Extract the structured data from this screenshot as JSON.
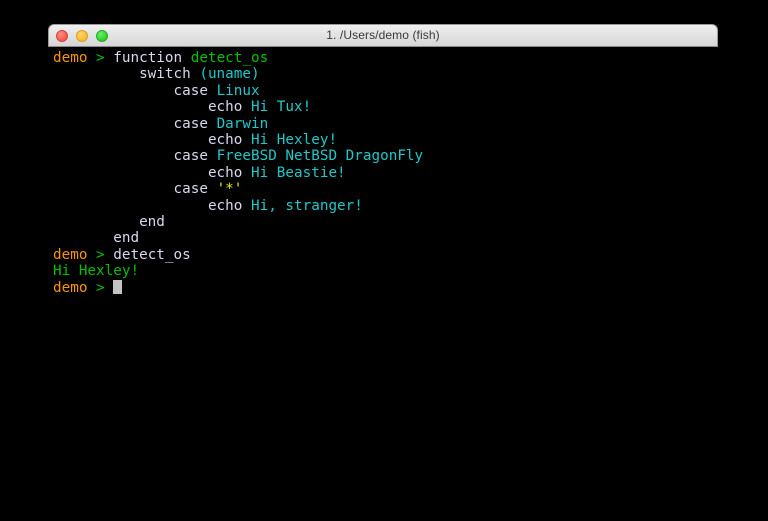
{
  "window": {
    "title": "1. /Users/demo (fish)",
    "controls": [
      {
        "name": "close",
        "label": "Close"
      },
      {
        "name": "minimize",
        "label": "Minimize"
      },
      {
        "name": "zoom",
        "label": "Zoom"
      }
    ]
  },
  "colors": {
    "background": "#000000",
    "prompt_user": "#f89406",
    "prompt_arrow": "#00c000",
    "command": "#d8d8f0",
    "function_name": "#00c000",
    "parameter": "#1fc8c8",
    "quoted_string": "#e8e800",
    "output": "#00c000",
    "cursor": "#c3c3c3",
    "titlebar": "#e4e4e4"
  },
  "terminal": {
    "shell": "fish",
    "prompt_user": "demo",
    "prompt_arrow": ">",
    "lines": [
      {
        "id": "line-1",
        "type": "prompt",
        "indent": "",
        "prompt_user": "demo",
        "prompt_arrow": ">",
        "segments": [
          {
            "text": " ",
            "style": "plain"
          },
          {
            "text": "function",
            "style": "command"
          },
          {
            "text": " ",
            "style": "plain"
          },
          {
            "text": "detect_os",
            "style": "funcname"
          }
        ]
      },
      {
        "id": "line-2",
        "type": "continuation",
        "indent": "          ",
        "segments": [
          {
            "text": "switch",
            "style": "command"
          },
          {
            "text": " ",
            "style": "plain"
          },
          {
            "text": "(uname)",
            "style": "paren"
          }
        ]
      },
      {
        "id": "line-3",
        "type": "continuation",
        "indent": "              ",
        "segments": [
          {
            "text": "case",
            "style": "command"
          },
          {
            "text": " ",
            "style": "plain"
          },
          {
            "text": "Linux",
            "style": "param"
          }
        ]
      },
      {
        "id": "line-4",
        "type": "continuation",
        "indent": "                  ",
        "segments": [
          {
            "text": "echo",
            "style": "command"
          },
          {
            "text": " ",
            "style": "plain"
          },
          {
            "text": "Hi Tux!",
            "style": "param"
          }
        ]
      },
      {
        "id": "line-5",
        "type": "continuation",
        "indent": "              ",
        "segments": [
          {
            "text": "case",
            "style": "command"
          },
          {
            "text": " ",
            "style": "plain"
          },
          {
            "text": "Darwin",
            "style": "param"
          }
        ]
      },
      {
        "id": "line-6",
        "type": "continuation",
        "indent": "                  ",
        "segments": [
          {
            "text": "echo",
            "style": "command"
          },
          {
            "text": " ",
            "style": "plain"
          },
          {
            "text": "Hi Hexley!",
            "style": "param"
          }
        ]
      },
      {
        "id": "line-7",
        "type": "continuation",
        "indent": "              ",
        "segments": [
          {
            "text": "case",
            "style": "command"
          },
          {
            "text": " ",
            "style": "plain"
          },
          {
            "text": "FreeBSD NetBSD DragonFly",
            "style": "param"
          }
        ]
      },
      {
        "id": "line-8",
        "type": "continuation",
        "indent": "                  ",
        "segments": [
          {
            "text": "echo",
            "style": "command"
          },
          {
            "text": " ",
            "style": "plain"
          },
          {
            "text": "Hi Beastie!",
            "style": "param"
          }
        ]
      },
      {
        "id": "line-9",
        "type": "continuation",
        "indent": "              ",
        "segments": [
          {
            "text": "case",
            "style": "command"
          },
          {
            "text": " ",
            "style": "plain"
          },
          {
            "text": "'*'",
            "style": "quote"
          }
        ]
      },
      {
        "id": "line-10",
        "type": "continuation",
        "indent": "                  ",
        "segments": [
          {
            "text": "echo",
            "style": "command"
          },
          {
            "text": " ",
            "style": "plain"
          },
          {
            "text": "Hi, stranger!",
            "style": "param"
          }
        ]
      },
      {
        "id": "line-11",
        "type": "continuation",
        "indent": "          ",
        "segments": [
          {
            "text": "end",
            "style": "command"
          }
        ]
      },
      {
        "id": "line-12",
        "type": "continuation",
        "indent": "       ",
        "segments": [
          {
            "text": "end",
            "style": "command"
          }
        ]
      },
      {
        "id": "line-13",
        "type": "prompt",
        "indent": "",
        "prompt_user": "demo",
        "prompt_arrow": ">",
        "segments": [
          {
            "text": " ",
            "style": "plain"
          },
          {
            "text": "detect_os",
            "style": "command"
          }
        ]
      },
      {
        "id": "line-14",
        "type": "output",
        "indent": "",
        "segments": [
          {
            "text": "Hi Hexley!",
            "style": "output"
          }
        ]
      },
      {
        "id": "line-15",
        "type": "prompt-cursor",
        "indent": "",
        "prompt_user": "demo",
        "prompt_arrow": ">",
        "segments": [
          {
            "text": " ",
            "style": "plain"
          }
        ]
      }
    ]
  }
}
